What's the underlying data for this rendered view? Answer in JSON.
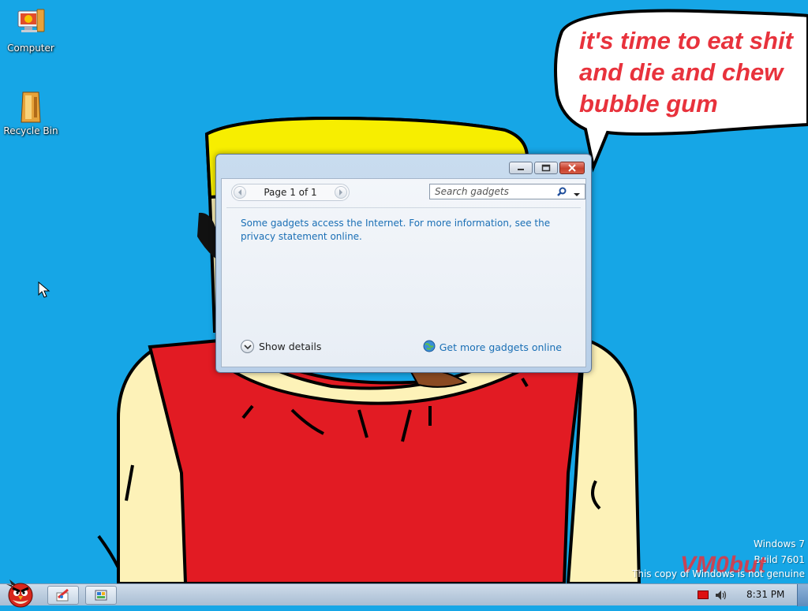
{
  "desktop": {
    "icons": [
      {
        "label": "Computer",
        "icon": "computer-icon"
      },
      {
        "label": "Recycle Bin",
        "icon": "recycle-bin-icon"
      }
    ],
    "speech_bubble": {
      "lines": [
        "it's time to eat shit",
        "and die and chew",
        "bubble gum"
      ]
    },
    "background_color": "#16a6e6"
  },
  "gadget_window": {
    "pager_label": "Page 1 of 1",
    "search_placeholder": "Search gadgets",
    "info_text": "Some gadgets access the Internet.  For more information, see the privacy statement online.",
    "show_details_label": "Show details",
    "get_more_label": "Get more gadgets online",
    "link_color": "#1a6fb5"
  },
  "watermark": {
    "line1": "Windows 7",
    "line2": "Build 7601",
    "line3": "This copy of Windows is not genuine",
    "overlay": "VM0but"
  },
  "taskbar": {
    "clock": "8:31 PM",
    "apps": [
      "paint-app-icon",
      "control-panel-app-icon"
    ]
  }
}
